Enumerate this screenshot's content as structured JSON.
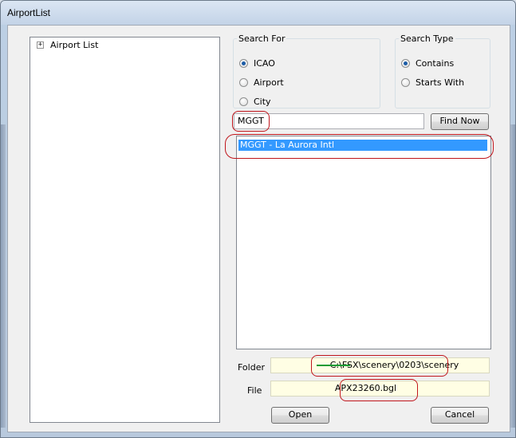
{
  "window": {
    "title": "AirportList"
  },
  "tree": {
    "expander": "+",
    "root_label": "Airport List"
  },
  "search_for": {
    "legend": "Search For",
    "options": [
      {
        "label": "ICAO",
        "checked": true
      },
      {
        "label": "Airport",
        "checked": false
      },
      {
        "label": "City",
        "checked": false
      }
    ]
  },
  "search_type": {
    "legend": "Search Type",
    "options": [
      {
        "label": "Contains",
        "checked": true
      },
      {
        "label": "Starts With",
        "checked": false
      }
    ]
  },
  "search": {
    "value": "MGGT",
    "find_label": "Find  Now"
  },
  "results": {
    "items": [
      "MGGT - La Aurora Intl"
    ],
    "selected_index": 0
  },
  "folder": {
    "label": "Folder",
    "value": "C:\\FSX\\scenery\\0203\\scenery"
  },
  "file": {
    "label": "File",
    "value": "APX23260.bgl"
  },
  "actions": {
    "open_label": "Open",
    "cancel_label": "Cancel"
  },
  "colors": {
    "selection": "#3399ff",
    "annotation": "#c0161c",
    "strike": "#1a9b35"
  }
}
